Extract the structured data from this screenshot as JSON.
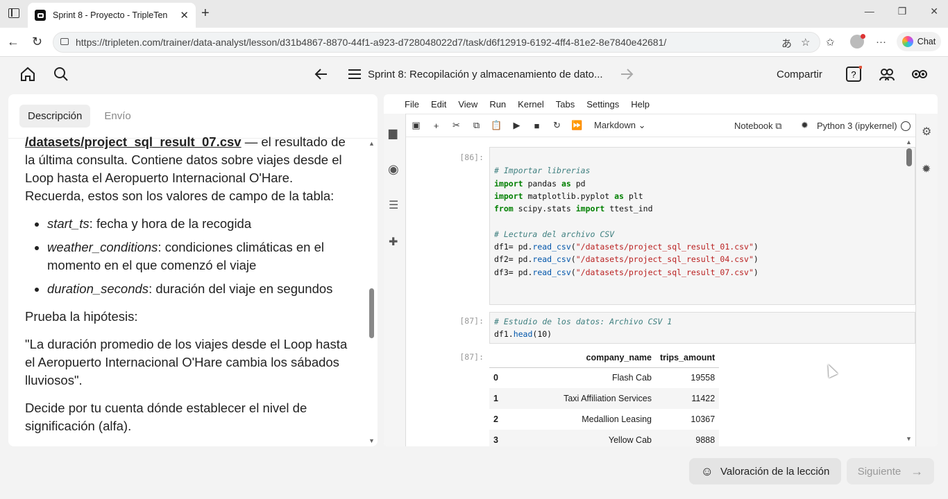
{
  "browser": {
    "tab_title": "Sprint 8 - Proyecto - TripleTen",
    "url": "https://tripleten.com/trainer/data-analyst/lesson/d31b4867-8870-44f1-a923-d728048022d7/task/d6f12919-6192-4ff4-81e2-8e7840e42681/",
    "chat_label": "Chat"
  },
  "header": {
    "breadcrumb": "Sprint 8: Recopilación y almacenamiento de dato...",
    "share_label": "Compartir"
  },
  "panel": {
    "tabs": [
      "Descripción",
      "Envío"
    ],
    "path_bold": "/datasets/project_sql_result_07.csv",
    "para1_rest": " — el resultado de la última consulta. Contiene datos sobre viajes desde el Loop hasta el Aeropuerto Internacional O'Hare. Recuerda, estos son los valores de campo de la tabla:",
    "fields": [
      {
        "name": "start_ts",
        "desc": ": fecha y hora de la recogida"
      },
      {
        "name": "weather_conditions",
        "desc": ": condiciones climáticas en el momento en el que comenzó el viaje"
      },
      {
        "name": "duration_seconds",
        "desc": ": duración del viaje en segundos"
      }
    ],
    "para2": "Prueba la hipótesis:",
    "para3": "\"La duración promedio de los viajes desde el Loop hasta el Aeropuerto Internacional O'Hare cambia los sábados lluviosos\".",
    "para4": "Decide por tu cuenta dónde establecer el nivel de significación (alfa)."
  },
  "jupyter": {
    "menu": [
      "File",
      "Edit",
      "View",
      "Run",
      "Kernel",
      "Tabs",
      "Settings",
      "Help"
    ],
    "cell_type": "Markdown",
    "notebook_label": "Notebook",
    "kernel": "Python 3 (ipykernel)",
    "cell1_prompt": "[86]:",
    "cell2_prompt": "[87]:",
    "out_prompt": "[87]:",
    "table": {
      "columns": [
        "",
        "company_name",
        "trips_amount"
      ],
      "rows": [
        [
          "0",
          "Flash Cab",
          "19558"
        ],
        [
          "1",
          "Taxi Affiliation Services",
          "11422"
        ],
        [
          "2",
          "Medallion Leasing",
          "10367"
        ],
        [
          "3",
          "Yellow Cab",
          "9888"
        ]
      ]
    }
  },
  "footer": {
    "rate_label": "Valoración de la lección",
    "next_label": "Siguiente"
  }
}
